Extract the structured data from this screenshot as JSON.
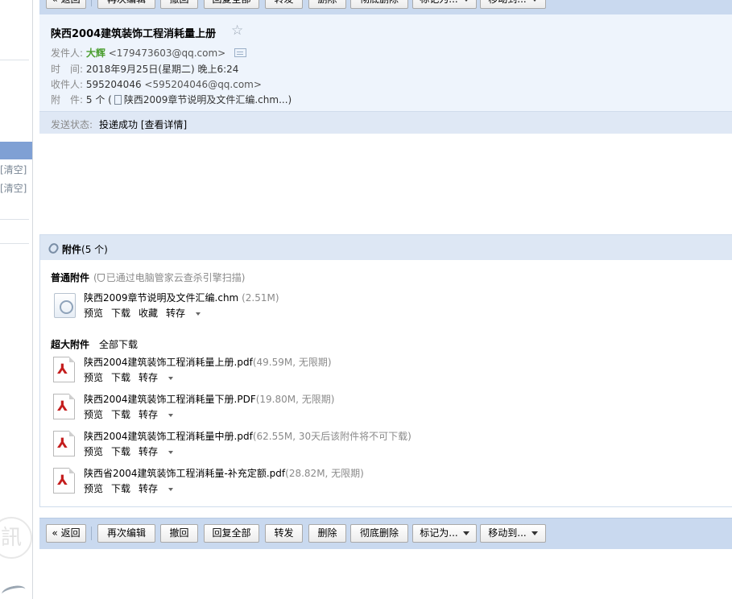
{
  "toolbar": {
    "back": "« 返回",
    "reedit": "再次编辑",
    "recall": "撤回",
    "reply_all": "回复全部",
    "forward": "转发",
    "delete": "删除",
    "perm_delete": "彻底删除",
    "mark_as": "标记为...",
    "move_to": "移动到..."
  },
  "sidebar": {
    "clear_1": "[清空]",
    "clear_2": "[清空]"
  },
  "mail": {
    "subject": "陕西2004建筑装饰工程消耗量上册",
    "star": "☆",
    "from_label": "发件人:",
    "from_name": "大辉",
    "from_addr": "<179473603@qq.com>",
    "time_label": "时　间:",
    "time": "2018年9月25日(星期二) 晚上6:24",
    "to_label": "收件人:",
    "to_name": "595204046",
    "to_addr": "<595204046@qq.com>",
    "att_label": "附　件:",
    "att_summary_count": "5 个 (",
    "att_summary_file": "陕西2009章节说明及文件汇编.chm...)",
    "status_label": "发送状态:",
    "status": "投递成功 [查看详情]"
  },
  "attachments": {
    "title": "附件",
    "count": "(5 个)",
    "normal_title": "普通附件",
    "scan_open": "(",
    "scan_text": "已通过电脑管家云查杀引擎扫描)",
    "normal_file": {
      "name": "陕西2009章节说明及文件汇编.chm",
      "meta": "(2.51M)",
      "preview": "预览",
      "download": "下载",
      "favorite": "收藏",
      "save": "转存"
    },
    "large_title": "超大附件",
    "download_all": "全部下载",
    "large_files": [
      {
        "name": "陕西2004建筑装饰工程消耗量上册.pdf",
        "meta": "(49.59M, 无限期)",
        "preview": "预览",
        "download": "下载",
        "save": "转存"
      },
      {
        "name": "陕西2004建筑装饰工程消耗量下册.PDF",
        "meta": "(19.80M, 无限期)",
        "preview": "预览",
        "download": "下载",
        "save": "转存"
      },
      {
        "name": "陕西2004建筑装饰工程消耗量中册.pdf",
        "meta": "(62.55M, 30天后该附件将不可下载)",
        "preview": "预览",
        "download": "下载",
        "save": "转存"
      },
      {
        "name": "陕西省2004建筑装饰工程消耗量-补充定额.pdf",
        "meta": "(28.82M, 无限期)",
        "preview": "预览",
        "download": "下载",
        "save": "转存"
      }
    ]
  },
  "colors": {
    "toolbar_bg": "#c9d9ef",
    "header_bg": "#eef4fc",
    "sender_green": "#4a9e2f",
    "sidebar_highlight": "#7fa0d4",
    "pdf_red": "#c41e1e"
  },
  "icons": [
    "star-icon",
    "vcard-icon",
    "file-icon",
    "paperclip-icon",
    "shield-icon",
    "chm-file-icon",
    "pdf-file-icon",
    "caret-down-icon"
  ]
}
